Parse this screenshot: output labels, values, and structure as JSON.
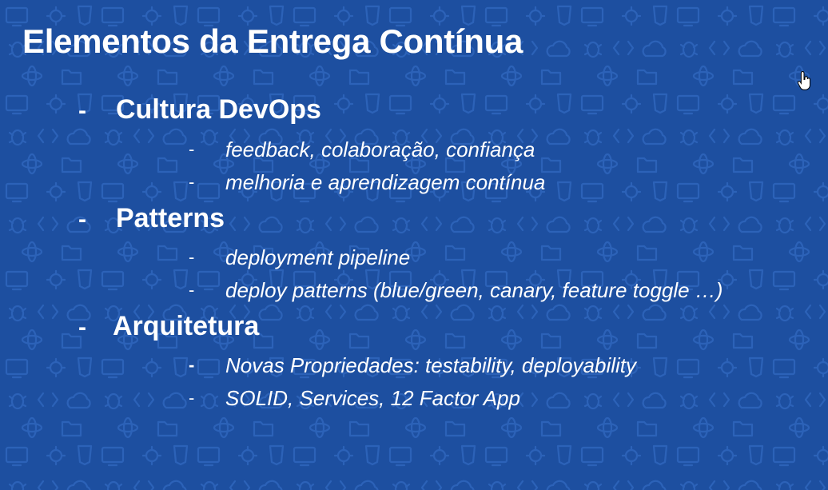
{
  "slide": {
    "title": "Elementos da Entrega Contínua",
    "bullet_marker": "-",
    "sections": [
      {
        "heading": "Cultura DevOps",
        "items": [
          "feedback, colaboração, confiança",
          "melhoria e aprendizagem contínua"
        ]
      },
      {
        "heading": "Patterns",
        "items": [
          "deployment pipeline",
          "deploy patterns (blue/green, canary, feature toggle …)"
        ]
      },
      {
        "heading": "Arquitetura",
        "items": [
          "Novas Propriedades: testability, deployability",
          "SOLID, Services, 12 Factor App"
        ]
      }
    ]
  },
  "colors": {
    "background": "#1d4fa0",
    "pattern": "#2c62b8",
    "text": "#ffffff"
  },
  "icons": {
    "background": "tech-icons-pattern",
    "cursor": "hand-pointer-cursor-icon"
  }
}
